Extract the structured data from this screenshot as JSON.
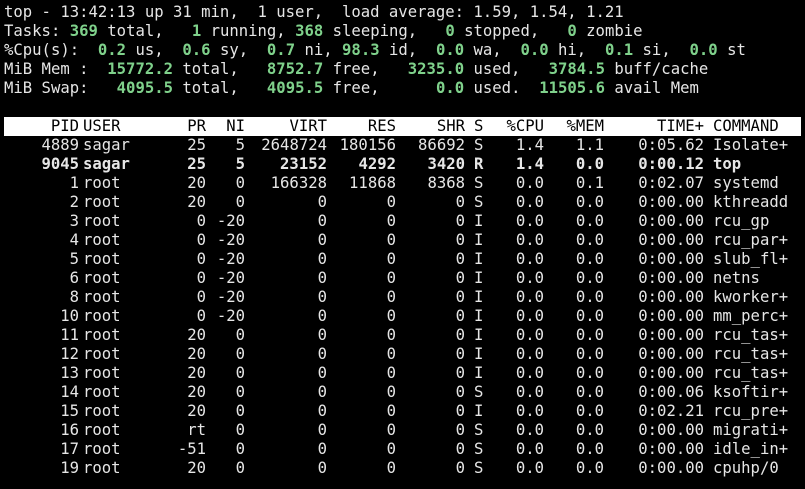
{
  "summary": {
    "l1": {
      "prefix": "top - 13:42:13 up 31 min,  1 user,  load average: 1.59, 1.54, 1.21"
    },
    "l2": {
      "label": "Tasks:",
      "total": "369",
      "total_lbl": "total,",
      "running": "1",
      "running_lbl": "running,",
      "sleeping": "368",
      "sleeping_lbl": "sleeping,",
      "stopped": "0",
      "stopped_lbl": "stopped,",
      "zombie": "0",
      "zombie_lbl": "zombie"
    },
    "l3": {
      "label": "%Cpu(s):",
      "us": "0.2",
      "us_lbl": "us,",
      "sy": "0.6",
      "sy_lbl": "sy,",
      "ni": "0.7",
      "ni_lbl": "ni,",
      "id": "98.3",
      "id_lbl": "id,",
      "wa": "0.0",
      "wa_lbl": "wa,",
      "hi": "0.0",
      "hi_lbl": "hi,",
      "si": "0.1",
      "si_lbl": "si,",
      "st": "0.0",
      "st_lbl": "st"
    },
    "l4": {
      "label": "MiB Mem :",
      "total": "15772.2",
      "total_lbl": "total,",
      "free": "8752.7",
      "free_lbl": "free,",
      "used": "3235.0",
      "used_lbl": "used,",
      "buff": "3784.5",
      "buff_lbl": "buff/cache"
    },
    "l5": {
      "label": "MiB Swap:",
      "total": "4095.5",
      "total_lbl": "total,",
      "free": "4095.5",
      "free_lbl": "free,",
      "used": "0.0",
      "used_lbl": "used.",
      "avail": "11505.6",
      "avail_lbl": "avail Mem"
    }
  },
  "columns": {
    "pid": "PID",
    "user": "USER",
    "pr": "PR",
    "ni": "NI",
    "virt": "VIRT",
    "res": "RES",
    "shr": "SHR",
    "s": "S",
    "cpu": "%CPU",
    "mem": "%MEM",
    "time": "TIME+",
    "cmd": "COMMAND"
  },
  "processes": [
    {
      "pid": "4889",
      "user": "sagar",
      "pr": "25",
      "ni": "5",
      "virt": "2648724",
      "res": "180156",
      "shr": "86692",
      "s": "S",
      "cpu": "1.4",
      "mem": "1.1",
      "time": "0:05.62",
      "cmd": "Isolate+",
      "hl": false
    },
    {
      "pid": "9045",
      "user": "sagar",
      "pr": "25",
      "ni": "5",
      "virt": "23152",
      "res": "4292",
      "shr": "3420",
      "s": "R",
      "cpu": "1.4",
      "mem": "0.0",
      "time": "0:00.12",
      "cmd": "top",
      "hl": true
    },
    {
      "pid": "1",
      "user": "root",
      "pr": "20",
      "ni": "0",
      "virt": "166328",
      "res": "11868",
      "shr": "8368",
      "s": "S",
      "cpu": "0.0",
      "mem": "0.1",
      "time": "0:02.07",
      "cmd": "systemd",
      "hl": false
    },
    {
      "pid": "2",
      "user": "root",
      "pr": "20",
      "ni": "0",
      "virt": "0",
      "res": "0",
      "shr": "0",
      "s": "S",
      "cpu": "0.0",
      "mem": "0.0",
      "time": "0:00.00",
      "cmd": "kthreadd",
      "hl": false
    },
    {
      "pid": "3",
      "user": "root",
      "pr": "0",
      "ni": "-20",
      "virt": "0",
      "res": "0",
      "shr": "0",
      "s": "I",
      "cpu": "0.0",
      "mem": "0.0",
      "time": "0:00.00",
      "cmd": "rcu_gp",
      "hl": false
    },
    {
      "pid": "4",
      "user": "root",
      "pr": "0",
      "ni": "-20",
      "virt": "0",
      "res": "0",
      "shr": "0",
      "s": "I",
      "cpu": "0.0",
      "mem": "0.0",
      "time": "0:00.00",
      "cmd": "rcu_par+",
      "hl": false
    },
    {
      "pid": "5",
      "user": "root",
      "pr": "0",
      "ni": "-20",
      "virt": "0",
      "res": "0",
      "shr": "0",
      "s": "I",
      "cpu": "0.0",
      "mem": "0.0",
      "time": "0:00.00",
      "cmd": "slub_fl+",
      "hl": false
    },
    {
      "pid": "6",
      "user": "root",
      "pr": "0",
      "ni": "-20",
      "virt": "0",
      "res": "0",
      "shr": "0",
      "s": "I",
      "cpu": "0.0",
      "mem": "0.0",
      "time": "0:00.00",
      "cmd": "netns",
      "hl": false
    },
    {
      "pid": "8",
      "user": "root",
      "pr": "0",
      "ni": "-20",
      "virt": "0",
      "res": "0",
      "shr": "0",
      "s": "I",
      "cpu": "0.0",
      "mem": "0.0",
      "time": "0:00.00",
      "cmd": "kworker+",
      "hl": false
    },
    {
      "pid": "10",
      "user": "root",
      "pr": "0",
      "ni": "-20",
      "virt": "0",
      "res": "0",
      "shr": "0",
      "s": "I",
      "cpu": "0.0",
      "mem": "0.0",
      "time": "0:00.00",
      "cmd": "mm_perc+",
      "hl": false
    },
    {
      "pid": "11",
      "user": "root",
      "pr": "20",
      "ni": "0",
      "virt": "0",
      "res": "0",
      "shr": "0",
      "s": "I",
      "cpu": "0.0",
      "mem": "0.0",
      "time": "0:00.00",
      "cmd": "rcu_tas+",
      "hl": false
    },
    {
      "pid": "12",
      "user": "root",
      "pr": "20",
      "ni": "0",
      "virt": "0",
      "res": "0",
      "shr": "0",
      "s": "I",
      "cpu": "0.0",
      "mem": "0.0",
      "time": "0:00.00",
      "cmd": "rcu_tas+",
      "hl": false
    },
    {
      "pid": "13",
      "user": "root",
      "pr": "20",
      "ni": "0",
      "virt": "0",
      "res": "0",
      "shr": "0",
      "s": "I",
      "cpu": "0.0",
      "mem": "0.0",
      "time": "0:00.00",
      "cmd": "rcu_tas+",
      "hl": false
    },
    {
      "pid": "14",
      "user": "root",
      "pr": "20",
      "ni": "0",
      "virt": "0",
      "res": "0",
      "shr": "0",
      "s": "S",
      "cpu": "0.0",
      "mem": "0.0",
      "time": "0:00.06",
      "cmd": "ksoftir+",
      "hl": false
    },
    {
      "pid": "15",
      "user": "root",
      "pr": "20",
      "ni": "0",
      "virt": "0",
      "res": "0",
      "shr": "0",
      "s": "I",
      "cpu": "0.0",
      "mem": "0.0",
      "time": "0:02.21",
      "cmd": "rcu_pre+",
      "hl": false
    },
    {
      "pid": "16",
      "user": "root",
      "pr": "rt",
      "ni": "0",
      "virt": "0",
      "res": "0",
      "shr": "0",
      "s": "S",
      "cpu": "0.0",
      "mem": "0.0",
      "time": "0:00.00",
      "cmd": "migrati+",
      "hl": false
    },
    {
      "pid": "17",
      "user": "root",
      "pr": "-51",
      "ni": "0",
      "virt": "0",
      "res": "0",
      "shr": "0",
      "s": "S",
      "cpu": "0.0",
      "mem": "0.0",
      "time": "0:00.00",
      "cmd": "idle_in+",
      "hl": false
    },
    {
      "pid": "19",
      "user": "root",
      "pr": "20",
      "ni": "0",
      "virt": "0",
      "res": "0",
      "shr": "0",
      "s": "S",
      "cpu": "0.0",
      "mem": "0.0",
      "time": "0:00.00",
      "cmd": "cpuhp/0",
      "hl": false
    }
  ],
  "colors": {
    "background": "#000000",
    "text": "#e6e6e6",
    "accent_green": "#7fd18b",
    "header_bg": "#ffffff",
    "header_text": "#000000"
  }
}
